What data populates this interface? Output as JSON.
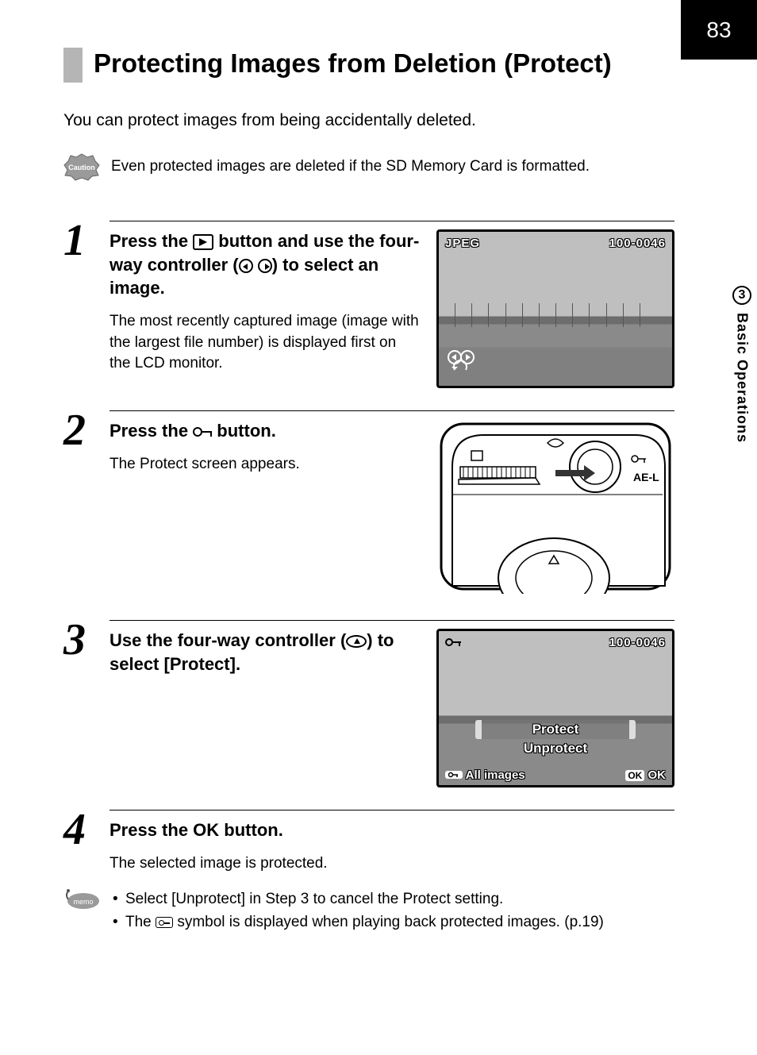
{
  "page_number": "83",
  "side_tab": {
    "chapter_number": "3",
    "chapter_title": "Basic Operations"
  },
  "title": "Protecting Images from Deletion (Protect)",
  "intro": "You can protect images from being accidentally deleted.",
  "caution": {
    "label": "Caution",
    "text": "Even protected images are deleted if the SD Memory Card is formatted."
  },
  "steps": {
    "s1": {
      "num": "1",
      "head_a": "Press the ",
      "head_b": " button and use the four-way controller (",
      "head_c": ") to select an image.",
      "desc": "The most recently captured image (image with the largest file number) is displayed first on the LCD monitor.",
      "lcd": {
        "format": "JPEG",
        "folder": "100-0046"
      }
    },
    "s2": {
      "num": "2",
      "head_a": "Press the ",
      "head_b": " button.",
      "desc": "The Protect screen appears.",
      "diagram_label": "AE-L"
    },
    "s3": {
      "num": "3",
      "head_a": "Use the four-way controller (",
      "head_b": ") to select [Protect].",
      "lcd": {
        "folder": "100-0046",
        "menu_protect": "Protect",
        "menu_unprotect": "Unprotect",
        "footer_all": "All images",
        "footer_ok_badge": "OK",
        "footer_ok": "OK"
      }
    },
    "s4": {
      "num": "4",
      "head_a": "Press the ",
      "ok": "OK",
      "head_b": " button.",
      "desc": "The selected image is protected."
    }
  },
  "memo": {
    "label": "memo",
    "items": {
      "i1": "Select [Unprotect] in Step 3 to cancel the Protect setting.",
      "i2a": "The ",
      "i2b": " symbol is displayed when playing back protected images. (p.19)"
    }
  }
}
